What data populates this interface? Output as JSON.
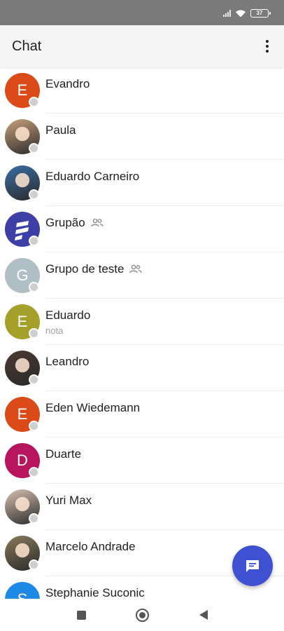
{
  "status_bar": {
    "battery": "37",
    "signal_icon": "signal-icon",
    "wifi_icon": "wifi-icon"
  },
  "app_bar": {
    "title": "Chat",
    "menu_icon": "more-vert-icon"
  },
  "chats": [
    {
      "name": "Evandro",
      "initial": "E",
      "color": "#dd4a19",
      "avatar": "letter",
      "group": false,
      "subtitle": ""
    },
    {
      "name": "Paula",
      "initial": "",
      "color": "#c8a27a",
      "avatar": "photo",
      "group": false,
      "subtitle": ""
    },
    {
      "name": "Eduardo Carneiro",
      "initial": "",
      "color": "#3a6ea5",
      "avatar": "photo",
      "group": false,
      "subtitle": ""
    },
    {
      "name": "Grupão",
      "initial": "",
      "color": "#3b3fa6",
      "avatar": "logo",
      "group": true,
      "subtitle": ""
    },
    {
      "name": "Grupo de teste",
      "initial": "G",
      "color": "#b0bec5",
      "avatar": "letter",
      "group": true,
      "subtitle": ""
    },
    {
      "name": "Eduardo",
      "initial": "E",
      "color": "#a4a02a",
      "avatar": "letter",
      "group": false,
      "subtitle": "nota"
    },
    {
      "name": "Leandro",
      "initial": "",
      "color": "#4a3a30",
      "avatar": "photo",
      "group": false,
      "subtitle": ""
    },
    {
      "name": "Eden Wiedemann",
      "initial": "E",
      "color": "#dd4a19",
      "avatar": "letter",
      "group": false,
      "subtitle": ""
    },
    {
      "name": "Duarte",
      "initial": "D",
      "color": "#b8135d",
      "avatar": "letter",
      "group": false,
      "subtitle": ""
    },
    {
      "name": "Yuri Max",
      "initial": "",
      "color": "#d8c1b0",
      "avatar": "photo",
      "group": false,
      "subtitle": ""
    },
    {
      "name": "Marcelo Andrade",
      "initial": "",
      "color": "#8a7a5a",
      "avatar": "photo",
      "group": false,
      "subtitle": ""
    },
    {
      "name": "Stephanie Suconic",
      "initial": "S",
      "color": "#1e88e5",
      "avatar": "letter",
      "group": false,
      "subtitle": ""
    }
  ],
  "fab": {
    "icon": "chat-bubble-icon",
    "color": "#3f51d3"
  },
  "nav_bar": {
    "recents_icon": "square-icon",
    "home_icon": "circle-icon",
    "back_icon": "triangle-back-icon"
  }
}
